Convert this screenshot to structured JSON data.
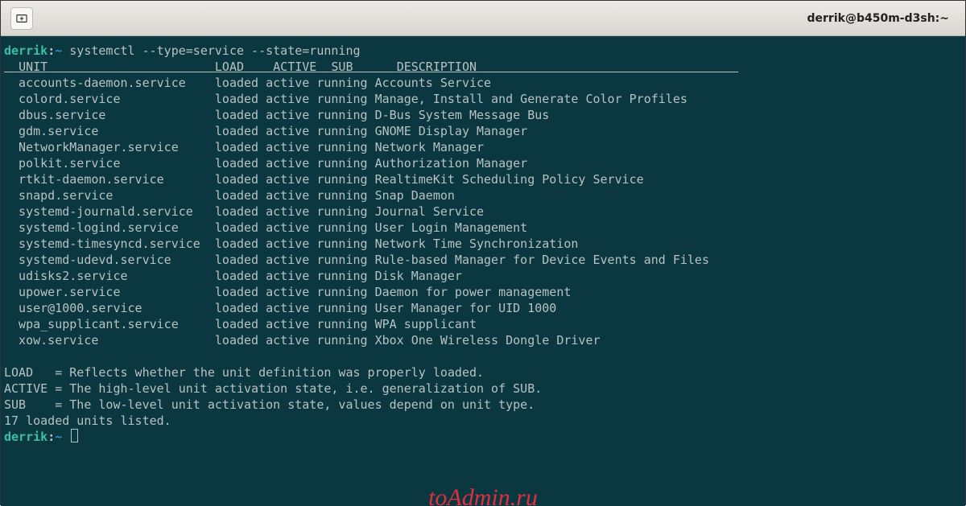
{
  "window": {
    "title": "derrik@b450m-d3sh:~"
  },
  "prompt": {
    "user": "derrik",
    "sep": ":",
    "path": "~",
    "command": "systemctl --type=service --state=running"
  },
  "columns": {
    "unit": "UNIT",
    "load": "LOAD",
    "active": "ACTIVE",
    "sub": "SUB",
    "description": "DESCRIPTION"
  },
  "services": [
    {
      "unit": "accounts-daemon.service",
      "load": "loaded",
      "active": "active",
      "sub": "running",
      "desc": "Accounts Service"
    },
    {
      "unit": "colord.service",
      "load": "loaded",
      "active": "active",
      "sub": "running",
      "desc": "Manage, Install and Generate Color Profiles"
    },
    {
      "unit": "dbus.service",
      "load": "loaded",
      "active": "active",
      "sub": "running",
      "desc": "D-Bus System Message Bus"
    },
    {
      "unit": "gdm.service",
      "load": "loaded",
      "active": "active",
      "sub": "running",
      "desc": "GNOME Display Manager"
    },
    {
      "unit": "NetworkManager.service",
      "load": "loaded",
      "active": "active",
      "sub": "running",
      "desc": "Network Manager"
    },
    {
      "unit": "polkit.service",
      "load": "loaded",
      "active": "active",
      "sub": "running",
      "desc": "Authorization Manager"
    },
    {
      "unit": "rtkit-daemon.service",
      "load": "loaded",
      "active": "active",
      "sub": "running",
      "desc": "RealtimeKit Scheduling Policy Service"
    },
    {
      "unit": "snapd.service",
      "load": "loaded",
      "active": "active",
      "sub": "running",
      "desc": "Snap Daemon"
    },
    {
      "unit": "systemd-journald.service",
      "load": "loaded",
      "active": "active",
      "sub": "running",
      "desc": "Journal Service"
    },
    {
      "unit": "systemd-logind.service",
      "load": "loaded",
      "active": "active",
      "sub": "running",
      "desc": "User Login Management"
    },
    {
      "unit": "systemd-timesyncd.service",
      "load": "loaded",
      "active": "active",
      "sub": "running",
      "desc": "Network Time Synchronization"
    },
    {
      "unit": "systemd-udevd.service",
      "load": "loaded",
      "active": "active",
      "sub": "running",
      "desc": "Rule-based Manager for Device Events and Files"
    },
    {
      "unit": "udisks2.service",
      "load": "loaded",
      "active": "active",
      "sub": "running",
      "desc": "Disk Manager"
    },
    {
      "unit": "upower.service",
      "load": "loaded",
      "active": "active",
      "sub": "running",
      "desc": "Daemon for power management"
    },
    {
      "unit": "user@1000.service",
      "load": "loaded",
      "active": "active",
      "sub": "running",
      "desc": "User Manager for UID 1000"
    },
    {
      "unit": "wpa_supplicant.service",
      "load": "loaded",
      "active": "active",
      "sub": "running",
      "desc": "WPA supplicant"
    },
    {
      "unit": "xow.service",
      "load": "loaded",
      "active": "active",
      "sub": "running",
      "desc": "Xbox One Wireless Dongle Driver"
    }
  ],
  "legend": {
    "load": "LOAD   = Reflects whether the unit definition was properly loaded.",
    "active": "ACTIVE = The high-level unit activation state, i.e. generalization of SUB.",
    "sub": "SUB    = The low-level unit activation state, values depend on unit type.",
    "count": "17 loaded units listed."
  },
  "watermark": "toAdmin.ru"
}
